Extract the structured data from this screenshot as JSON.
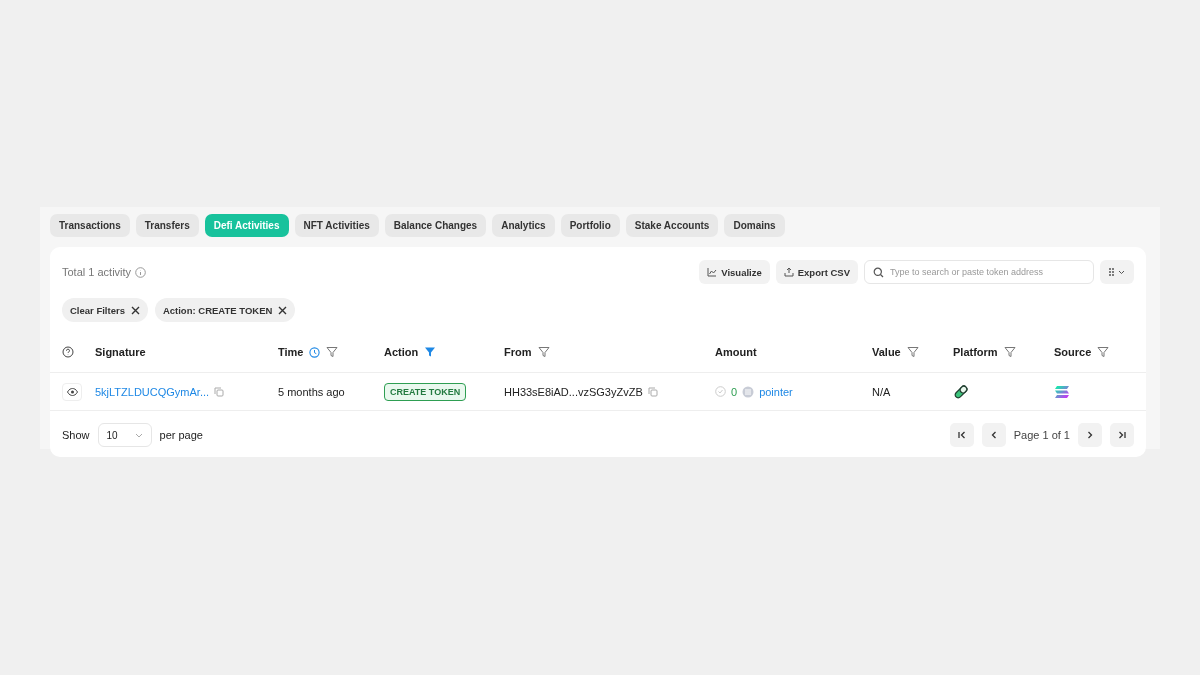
{
  "tabs": [
    {
      "label": "Transactions",
      "selected": false
    },
    {
      "label": "Transfers",
      "selected": false
    },
    {
      "label": "Defi Activities",
      "selected": true
    },
    {
      "label": "NFT Activities",
      "selected": false
    },
    {
      "label": "Balance Changes",
      "selected": false
    },
    {
      "label": "Analytics",
      "selected": false
    },
    {
      "label": "Portfolio",
      "selected": false
    },
    {
      "label": "Stake Accounts",
      "selected": false
    },
    {
      "label": "Domains",
      "selected": false
    }
  ],
  "total": "Total 1 activity",
  "toolbar": {
    "visualize": "Visualize",
    "export": "Export CSV",
    "search": {
      "placeholder": "Type to search or paste token address"
    }
  },
  "filters": [
    {
      "label": "Clear Filters"
    },
    {
      "label": "Action: CREATE TOKEN"
    }
  ],
  "table": {
    "columns": [
      {
        "label": "Signature",
        "sorted": false,
        "filterable": false
      },
      {
        "label": "Time",
        "sorted": true,
        "filterable": true,
        "filtered": false
      },
      {
        "label": "Action",
        "sorted": false,
        "filterable": true,
        "filtered": true
      },
      {
        "label": "From",
        "sorted": false,
        "filterable": true,
        "filtered": false
      },
      {
        "label": "Amount",
        "sorted": false,
        "filterable": false
      },
      {
        "label": "Value",
        "sorted": false,
        "filterable": true,
        "filtered": false
      },
      {
        "label": "Platform",
        "sorted": false,
        "filterable": true,
        "filtered": false
      },
      {
        "label": "Source",
        "sorted": false,
        "filterable": true,
        "filtered": false
      }
    ],
    "rows": [
      {
        "signature": "5kjLTZLDUCQGymAr...",
        "time": "5 months ago",
        "action": "CREATE TOKEN",
        "from": "HH33sE8iAD...vzSG3yZvZB",
        "amount": "0",
        "token": "pointer",
        "value": "N/A"
      }
    ]
  },
  "footer": {
    "show": "Show",
    "page_size": "10",
    "per_page": "per page",
    "page": "Page 1 of 1"
  }
}
